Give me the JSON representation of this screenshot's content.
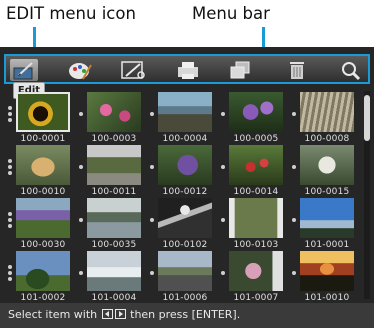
{
  "callouts": {
    "edit_menu_icon": "EDIT menu icon",
    "menu_bar": "Menu bar"
  },
  "colors": {
    "callout_line": "#1a9bd7",
    "screen_bg": "#262626",
    "status_bg": "#3a3a3a"
  },
  "menu": {
    "selected_index": 0,
    "tooltip": "Edit",
    "icons": [
      "edit-icon",
      "palette-icon",
      "tools-icon",
      "print-icon",
      "copy-icon",
      "trash-icon",
      "magnifier-icon"
    ]
  },
  "grid": {
    "selected_index": 0,
    "items": [
      {
        "label": "100-0001",
        "photo": "sunflower"
      },
      {
        "label": "100-0003",
        "photo": "pink-flowers"
      },
      {
        "label": "100-0004",
        "photo": "rocks-lake"
      },
      {
        "label": "100-0005",
        "photo": "purple-flowers"
      },
      {
        "label": "100-0008",
        "photo": "reeds"
      },
      {
        "label": "100-0010",
        "photo": "dog"
      },
      {
        "label": "100-0011",
        "photo": "house-tree"
      },
      {
        "label": "100-0012",
        "photo": "purple-cluster"
      },
      {
        "label": "100-0014",
        "photo": "red-flowers"
      },
      {
        "label": "100-0015",
        "photo": "white-blossoms"
      },
      {
        "label": "100-0030",
        "photo": "purple-garden"
      },
      {
        "label": "100-0035",
        "photo": "river-trees"
      },
      {
        "label": "100-0102",
        "photo": "palm-tree"
      },
      {
        "label": "100-0103",
        "photo": "garden-frame"
      },
      {
        "label": "101-0001",
        "photo": "blue-sky"
      },
      {
        "label": "101-0002",
        "photo": "tree-clouds"
      },
      {
        "label": "101-0004",
        "photo": "snow-trees"
      },
      {
        "label": "101-0006",
        "photo": "road"
      },
      {
        "label": "101-0007",
        "photo": "flower-bush"
      },
      {
        "label": "101-0010",
        "photo": "sunset-tree"
      }
    ]
  },
  "status": {
    "prefix": "Select item with",
    "suffix": "then press [ENTER].",
    "key_icons": [
      "left-arrow-key-icon",
      "right-arrow-key-icon"
    ]
  },
  "scrollbar": {
    "position_fraction": 0.0
  }
}
